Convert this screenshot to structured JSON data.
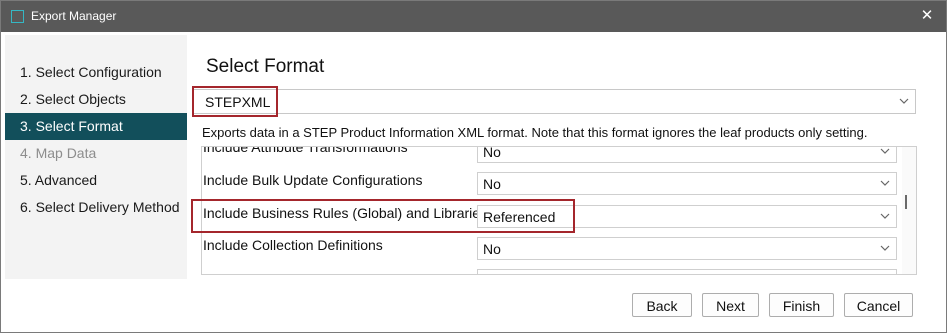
{
  "window": {
    "title": "Export Manager",
    "close_glyph": "✕"
  },
  "sidebar": {
    "steps": [
      {
        "label": "1. Select Configuration"
      },
      {
        "label": "2. Select Objects"
      },
      {
        "label": "3. Select Format"
      },
      {
        "label": "4. Map Data"
      },
      {
        "label": "5. Advanced"
      },
      {
        "label": "6. Select Delivery Method"
      }
    ]
  },
  "main": {
    "heading": "Select Format",
    "format_value": "STEPXML",
    "description": "Exports data in a STEP Product Information XML format. Note that this format ignores the leaf products only setting.",
    "options": [
      {
        "label": "Include Attribute Transformations",
        "value": "No"
      },
      {
        "label": "Include Bulk Update Configurations",
        "value": "No"
      },
      {
        "label": "Include Business Rules (Global) and Libraries",
        "value": "Referenced"
      },
      {
        "label": "Include Collection Definitions",
        "value": "No"
      },
      {
        "label": "",
        "value": ""
      }
    ]
  },
  "footer": {
    "back": "Back",
    "next": "Next",
    "finish": "Finish",
    "cancel": "Cancel"
  },
  "colors": {
    "title_bar": "#595959",
    "active_step": "#124f5b",
    "highlight": "#a4262c",
    "disabled_step": "#8d8d8d"
  }
}
